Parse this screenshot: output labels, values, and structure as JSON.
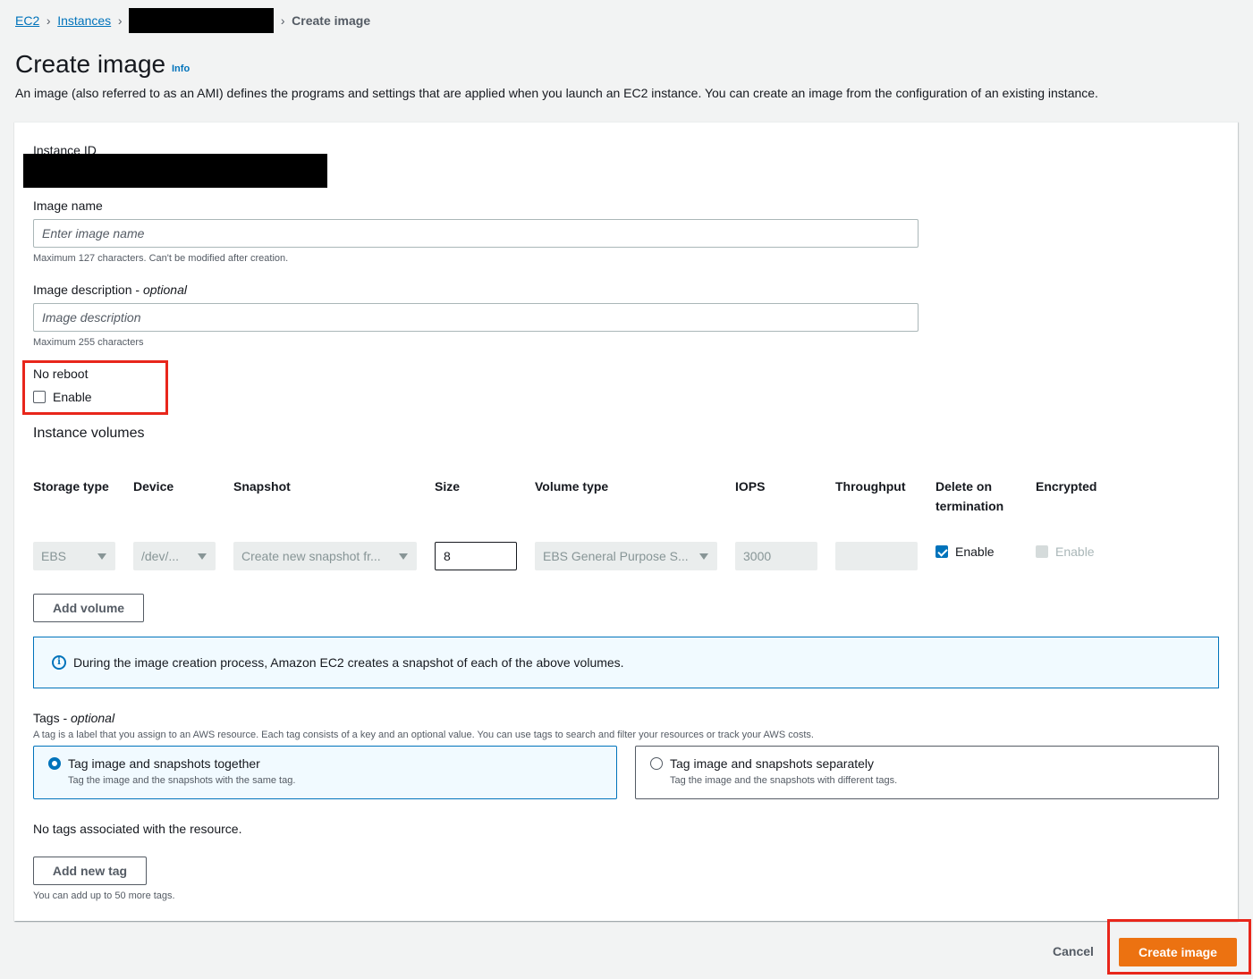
{
  "breadcrumb": {
    "ec2": "EC2",
    "instances": "Instances",
    "current": "Create image",
    "separator": ">"
  },
  "header": {
    "title": "Create image",
    "info": "Info",
    "description": "An image (also referred to as an AMI) defines the programs and settings that are applied when you launch an EC2 instance. You can create an image from the configuration of an existing instance."
  },
  "form": {
    "instance_id_label": "Instance ID",
    "image_name_label": "Image name",
    "image_name_placeholder": "Enter image name",
    "image_name_hint": "Maximum 127 characters. Can't be modified after creation.",
    "image_desc_label": "Image description - ",
    "image_desc_optional": "optional",
    "image_desc_placeholder": "Image description",
    "image_desc_hint": "Maximum 255 characters",
    "no_reboot_label": "No reboot",
    "no_reboot_enable": "Enable",
    "no_reboot_checked": false
  },
  "volumes": {
    "title": "Instance volumes",
    "columns": {
      "storage_type": "Storage type",
      "device": "Device",
      "snapshot": "Snapshot",
      "size": "Size",
      "volume_type": "Volume type",
      "iops": "IOPS",
      "throughput": "Throughput",
      "delete_on_termination_1": "Delete on",
      "delete_on_termination_2": "termination",
      "encrypted": "Encrypted"
    },
    "row": {
      "storage_type": "EBS",
      "device": "/dev/...",
      "snapshot": "Create new snapshot fr...",
      "size": "8",
      "volume_type": "EBS General Purpose S...",
      "iops": "3000",
      "throughput": "",
      "delete_on_termination": "Enable",
      "delete_on_termination_checked": true,
      "encrypted": "Enable",
      "encrypted_checked": false
    },
    "add_volume": "Add volume"
  },
  "alert": {
    "icon": "info-icon",
    "text": "During the image creation process, Amazon EC2 creates a snapshot of each of the above volumes."
  },
  "tags": {
    "label": "Tags - ",
    "optional": "optional",
    "description": "A tag is a label that you assign to an AWS resource. Each tag consists of a key and an optional value. You can use tags to search and filter your resources or track your AWS costs.",
    "options": [
      {
        "title": "Tag image and snapshots together",
        "desc": "Tag the image and the snapshots with the same tag.",
        "selected": true
      },
      {
        "title": "Tag image and snapshots separately",
        "desc": "Tag the image and the snapshots with different tags.",
        "selected": false
      }
    ],
    "empty": "No tags associated with the resource.",
    "add_tag": "Add new tag",
    "add_hint": "You can add up to 50 more tags."
  },
  "footer": {
    "cancel": "Cancel",
    "create": "Create image"
  },
  "colors": {
    "link": "#0073bb",
    "primary": "#ec7211",
    "highlight": "#e8261b",
    "background": "#f2f3f3"
  }
}
